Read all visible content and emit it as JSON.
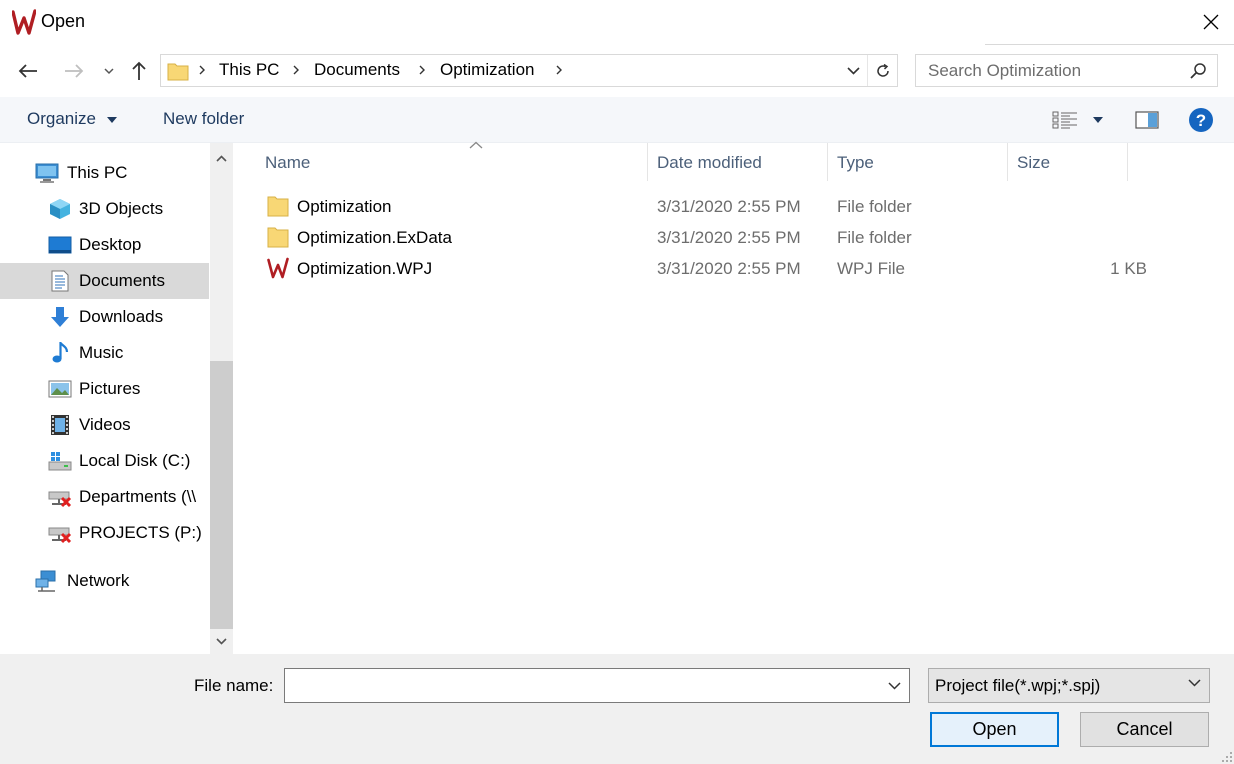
{
  "window": {
    "title": "Open",
    "app_icon": "w-logo-icon",
    "close_icon": "close-icon"
  },
  "nav": {
    "back_icon": "arrow-left-icon",
    "forward_icon": "arrow-right-icon",
    "recent_icon": "chevron-down-icon",
    "up_icon": "arrow-up-icon",
    "breadcrumbs": [
      "This PC",
      "Documents",
      "Optimization"
    ],
    "refresh_icon": "refresh-icon",
    "search_placeholder": "Search Optimization"
  },
  "toolbar": {
    "organize_label": "Organize",
    "new_folder_label": "New folder",
    "view_icon": "details-view-icon",
    "preview_icon": "preview-pane-icon",
    "help_icon": "help-icon"
  },
  "sidebar": {
    "items": [
      {
        "label": "This PC",
        "icon": "computer-icon"
      },
      {
        "label": "3D Objects",
        "icon": "cube-icon"
      },
      {
        "label": "Desktop",
        "icon": "desktop-icon"
      },
      {
        "label": "Documents",
        "icon": "document-icon",
        "selected": true
      },
      {
        "label": "Downloads",
        "icon": "download-icon"
      },
      {
        "label": "Music",
        "icon": "music-icon"
      },
      {
        "label": "Pictures",
        "icon": "pictures-icon"
      },
      {
        "label": "Videos",
        "icon": "videos-icon"
      },
      {
        "label": "Local Disk (C:)",
        "icon": "local-disk-icon"
      },
      {
        "label": "Departments (\\\\",
        "icon": "network-drive-disconnected-icon"
      },
      {
        "label": "PROJECTS (P:)",
        "icon": "network-drive-disconnected-icon"
      },
      {
        "label": "Network",
        "icon": "network-icon"
      }
    ]
  },
  "columns": {
    "name": "Name",
    "date": "Date modified",
    "type": "Type",
    "size": "Size"
  },
  "files": [
    {
      "name": "Optimization",
      "date": "3/31/2020 2:55 PM",
      "type": "File folder",
      "size": "",
      "icon": "folder-icon"
    },
    {
      "name": "Optimization.ExData",
      "date": "3/31/2020 2:55 PM",
      "type": "File folder",
      "size": "",
      "icon": "folder-icon"
    },
    {
      "name": "Optimization.WPJ",
      "date": "3/31/2020 2:55 PM",
      "type": "WPJ File",
      "size": "1 KB",
      "icon": "wpj-file-icon"
    }
  ],
  "footer": {
    "file_name_label": "File name:",
    "file_name_value": "",
    "filter_value": "Project file(*.wpj;*.spj)",
    "open_label": "Open",
    "cancel_label": "Cancel"
  },
  "colors": {
    "accent": "#0078d7",
    "logo_red": "#b01e23",
    "folder_yellow": "#f8d775"
  }
}
